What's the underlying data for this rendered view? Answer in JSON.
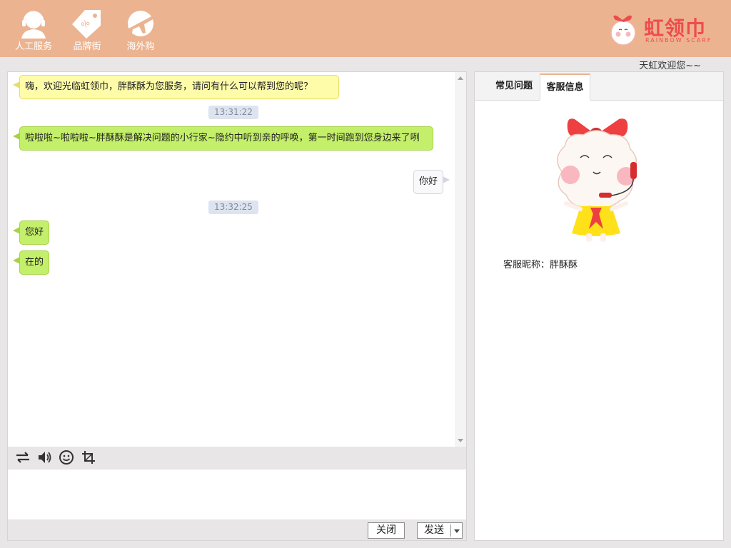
{
  "header": {
    "nav": [
      {
        "label": "人工服务",
        "icon": "customer-service-icon"
      },
      {
        "label": "品牌街",
        "icon": "price-tag-icon"
      },
      {
        "label": "海外购",
        "icon": "airplane-globe-icon"
      }
    ],
    "brand": {
      "name": "虹领巾",
      "subtitle": "RAINBOW SCARF",
      "icon": "rainbow-scarf-mascot-logo"
    },
    "welcome": "天虹欢迎您~~"
  },
  "chat": {
    "messages": [
      {
        "type": "agent",
        "style": "yellow",
        "text": "嗨，欢迎光临虹领巾，胖酥酥为您服务，请问有什么可以帮到您的呢？"
      },
      {
        "type": "time",
        "text": "13:31:22"
      },
      {
        "type": "agent",
        "style": "green",
        "text": "啦啦啦~啦啦啦~胖酥酥是解决问题的小行家~隐约中听到亲的呼唤，第一时间跑到您身边来了咧"
      },
      {
        "type": "user",
        "style": "white",
        "text": "你好"
      },
      {
        "type": "time",
        "text": "13:32:25"
      },
      {
        "type": "agent",
        "style": "green",
        "text": "您好"
      },
      {
        "type": "agent",
        "style": "green",
        "text": "在的"
      }
    ],
    "toolbar": [
      {
        "icon": "transfer-arrows-icon"
      },
      {
        "icon": "speaker-icon"
      },
      {
        "icon": "emoji-icon"
      },
      {
        "icon": "crop-screenshot-icon"
      }
    ],
    "input": {
      "value": "",
      "placeholder": ""
    },
    "close_label": "关闭",
    "send_label": "发送"
  },
  "info": {
    "tabs": [
      {
        "label": "常见问题",
        "active": false
      },
      {
        "label": "客服信息",
        "active": true
      }
    ],
    "avatar_icon": "cartoon-girl-headset-mascot",
    "nickname": "客服昵称：胖酥酥"
  },
  "colors": {
    "header_bg": "#ecb390",
    "bubble_yellow": "#fefca9",
    "bubble_green": "#c4ef6a",
    "brand_red": "#ee4c4c"
  }
}
